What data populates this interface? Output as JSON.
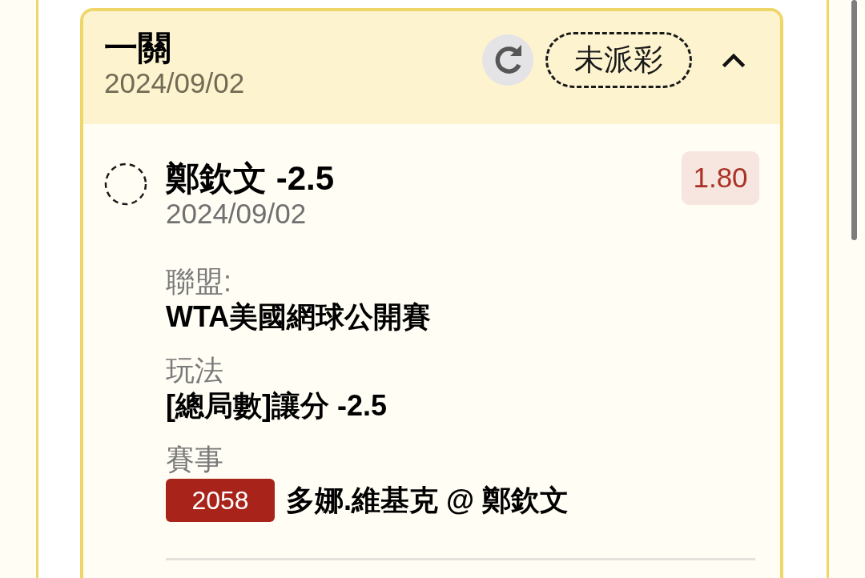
{
  "card": {
    "title": "一關",
    "date": "2024/09/02",
    "status": "未派彩",
    "expanded": true
  },
  "selection": {
    "title": "鄭欽文 -2.5",
    "date": "2024/09/02",
    "odds": "1.80",
    "fields": [
      {
        "kind": "text",
        "label": "聯盟:",
        "value": "WTA美國網球公開賽"
      },
      {
        "kind": "text",
        "label": "玩法",
        "value": "[總局數]讓分 -2.5"
      },
      {
        "kind": "match",
        "label": "賽事",
        "match_number": "2058",
        "value": "多娜.維基克 @ 鄭欽文"
      }
    ]
  }
}
